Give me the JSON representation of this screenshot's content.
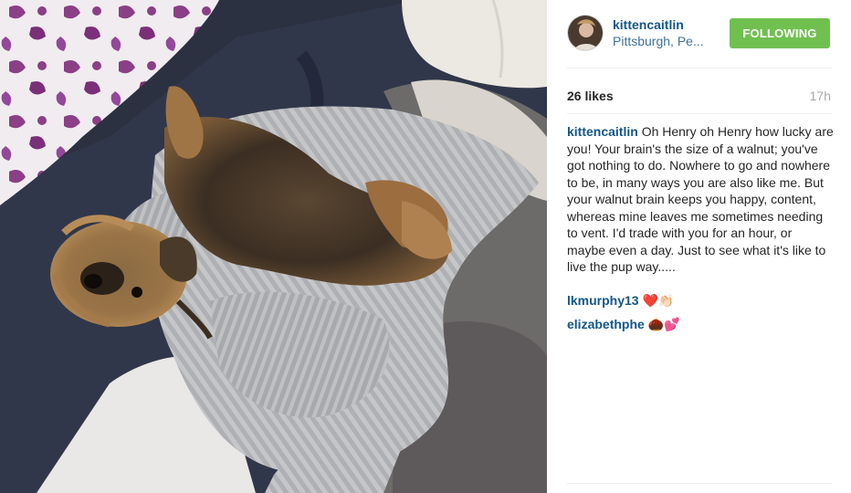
{
  "post": {
    "image": {
      "subject": "yorkshire-terrier-in-blanket"
    },
    "header": {
      "username": "kittencaitlin",
      "location": "Pittsburgh, Pe...",
      "follow_label": "FOLLOWING"
    },
    "stats": {
      "likes": "26 likes",
      "time": "17h"
    },
    "caption": {
      "username": "kittencaitlin",
      "text": "Oh Henry oh Henry how lucky are you! Your brain's the size of a walnut; you've got nothing to do. Nowhere to go and nowhere to be, in many ways you are also like me. But your walnut brain keeps you happy, content, whereas mine leaves me sometimes needing to vent. I'd trade with you for an hour, or maybe even a day. Just to see what it's like to live the pup way....."
    },
    "comments": [
      {
        "username": "lkmurphy13",
        "text": "❤️👏🏻"
      },
      {
        "username": "elizabethphe",
        "text": "🌰💕"
      }
    ]
  },
  "colors": {
    "username": "#125688",
    "location": "#3f729b",
    "follow_button": "#70c050",
    "timestamp": "#a5a7aa",
    "divider": "#efefef"
  }
}
